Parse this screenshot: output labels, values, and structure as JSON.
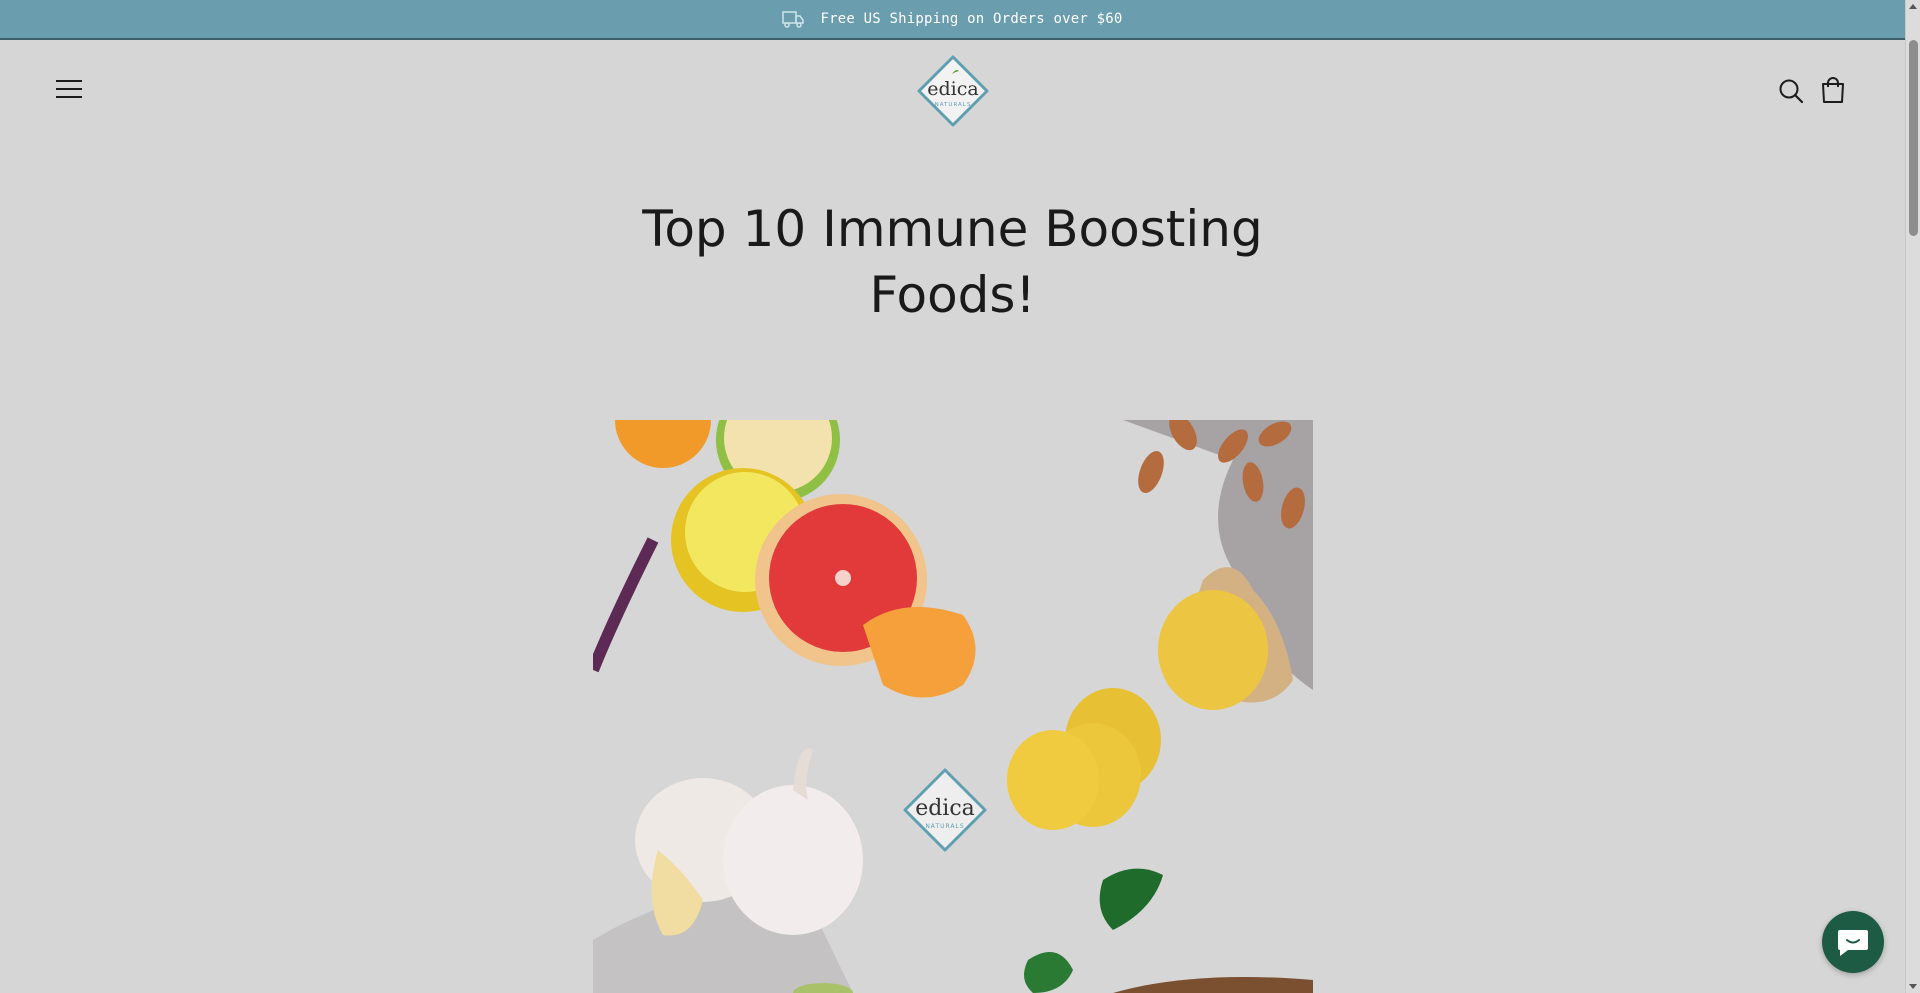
{
  "announcement": {
    "text": "Free US Shipping on Orders over $60",
    "icon": "truck-icon"
  },
  "header": {
    "menu_icon": "hamburger-menu-icon",
    "logo": {
      "brand": "edica",
      "tagline": "NATURALS"
    },
    "search_icon": "search-icon",
    "cart_icon": "shopping-bag-icon"
  },
  "article": {
    "title_line1": "Top 10 Immune Boosting",
    "title_line2": "Foods!"
  },
  "hero": {
    "logo": {
      "brand": "edica",
      "tagline": "NATURALS"
    }
  },
  "chat": {
    "icon": "chat-bubble-icon"
  },
  "colors": {
    "announcement_bg": "#6a9eae",
    "page_bg": "#d6d6d6",
    "logo_teal": "#5f9fb1",
    "chat_bg": "#1e5b45"
  }
}
